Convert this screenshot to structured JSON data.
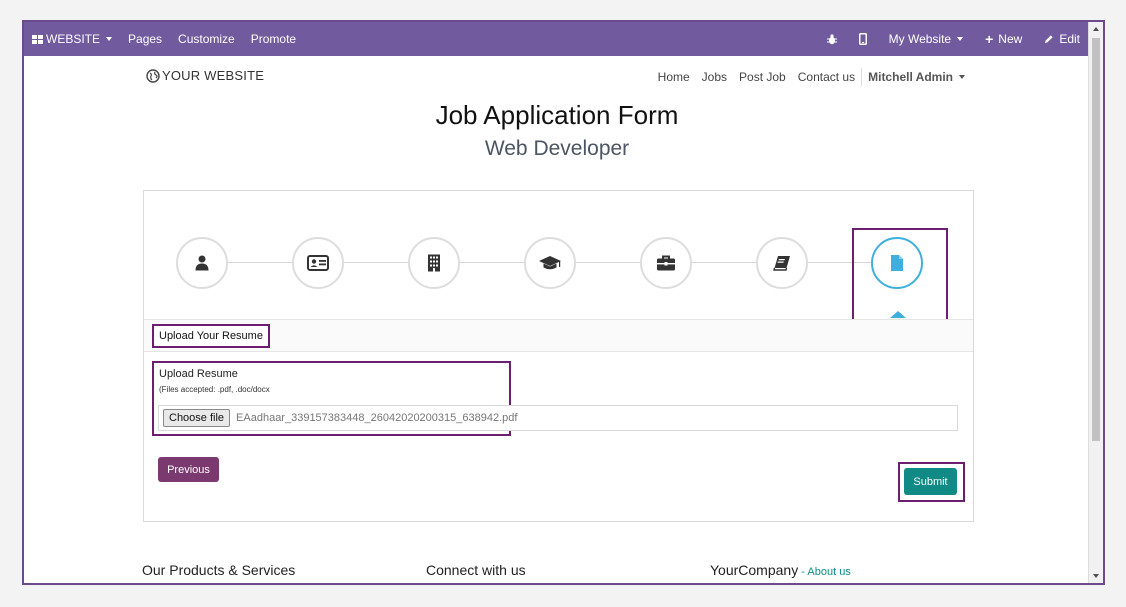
{
  "topbar": {
    "website": "WEBSITE",
    "pages": "Pages",
    "customize": "Customize",
    "promote": "Promote",
    "my_website": "My Website",
    "new": "New",
    "edit": "Edit"
  },
  "header": {
    "logo": "YOUR WEBSITE",
    "nav": [
      "Home",
      "Jobs",
      "Post Job",
      "Contact us"
    ],
    "user": "Mitchell Admin"
  },
  "page": {
    "title": "Job Application Form",
    "subtitle": "Web Developer"
  },
  "steps": [
    {
      "icon": "user-icon"
    },
    {
      "icon": "id-card-icon"
    },
    {
      "icon": "building-icon"
    },
    {
      "icon": "graduation-cap-icon"
    },
    {
      "icon": "briefcase-icon"
    },
    {
      "icon": "book-icon"
    },
    {
      "icon": "file-icon",
      "active": true
    }
  ],
  "form": {
    "section_title": "Upload Your Resume",
    "upload_label": "Upload Resume",
    "upload_help": "(Files accepted: .pdf, .doc/docx",
    "choose_file": "Choose file",
    "file_name": "EAadhaar_339157383448_26042020200315_638942.pdf",
    "previous": "Previous",
    "submit": "Submit"
  },
  "footer": {
    "col1": "Our Products & Services",
    "col2": "Connect with us",
    "col3": "YourCompany",
    "dash": " - ",
    "about": "About us"
  },
  "colors": {
    "topbar": "#725a9f",
    "active_step": "#3fb0dd",
    "submit": "#0f8a84",
    "previous": "#7b3a6f",
    "highlight": "#6b1f6e"
  }
}
